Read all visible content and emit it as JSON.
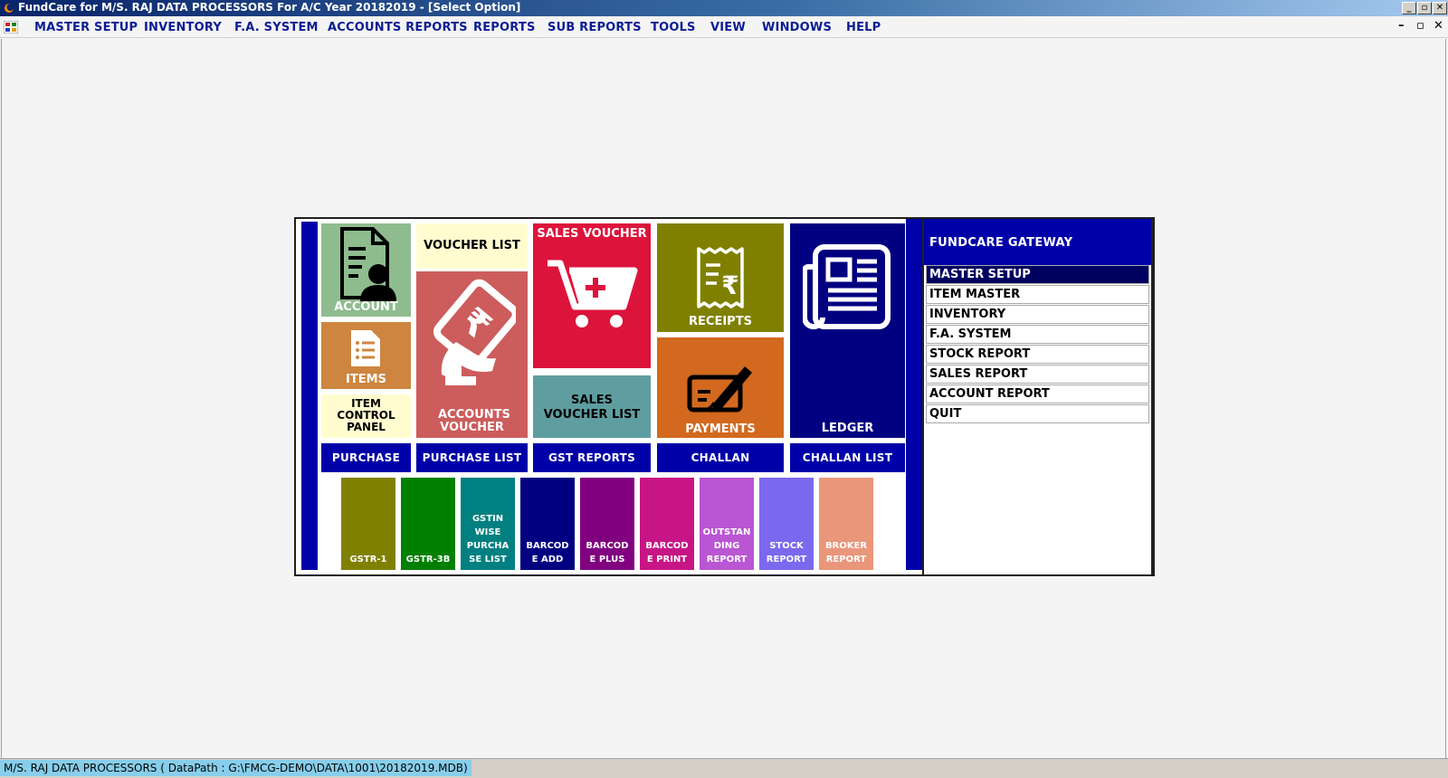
{
  "window": {
    "title": "FundCare  for M/S. RAJ DATA PROCESSORS For A/C Year 20182019 - [Select Option]",
    "controls": {
      "minimize": "_",
      "restore": "▫",
      "close": "✕"
    }
  },
  "menubar": {
    "items": [
      "MASTER SETUP",
      "INVENTORY",
      "F.A. SYSTEM",
      "ACCOUNTS REPORTS",
      "REPORTS",
      "SUB REPORTS",
      "TOOLS",
      "VIEW",
      "WINDOWS",
      "HELP"
    ],
    "child_controls": {
      "minimize": "–",
      "restore": "▫",
      "close": "✕"
    }
  },
  "tiles": {
    "account": {
      "label": "ACCOUNT",
      "color": "#8fbc8f"
    },
    "items": {
      "label": "ITEMS",
      "color": "#cd853f"
    },
    "item_control_panel": {
      "label": "ITEM CONTROL PANEL",
      "color": "#fffdd0"
    },
    "voucher_list": {
      "label": "VOUCHER LIST",
      "color": "#fffdd0"
    },
    "accounts_voucher": {
      "label": "ACCOUNTS VOUCHER",
      "color": "#cd5c5c"
    },
    "sales_voucher": {
      "label": "SALES VOUCHER",
      "color": "#dc143c"
    },
    "sales_voucher_list": {
      "label": "SALES VOUCHER LIST",
      "color": "#5f9ea0"
    },
    "receipts": {
      "label": "RECEIPTS",
      "color": "#808000"
    },
    "payments": {
      "label": "PAYMENTS",
      "color": "#d2691e"
    },
    "ledger": {
      "label": "LEDGER",
      "color": "#000080"
    }
  },
  "navy_buttons": [
    "PURCHASE",
    "PURCHASE LIST",
    "GST REPORTS",
    "CHALLAN",
    "CHALLAN LIST"
  ],
  "small_tiles": [
    {
      "label": "GSTR-1",
      "color": "#808000"
    },
    {
      "label": "GSTR-3B",
      "color": "#008000"
    },
    {
      "label": "GSTIN\nWISE\nPURCHA\nSE LIST",
      "color": "#008080"
    },
    {
      "label": "BARCOD\nE ADD",
      "color": "#000080"
    },
    {
      "label": "BARCOD\nE PLUS",
      "color": "#800080"
    },
    {
      "label": "BARCOD\nE PRINT",
      "color": "#c71585"
    },
    {
      "label": "OUTSTAN\nDING\nREPORT",
      "color": "#ba55d3"
    },
    {
      "label": "STOCK\nREPORT",
      "color": "#7b68ee"
    },
    {
      "label": "BROKER\nREPORT",
      "color": "#e9967a"
    }
  ],
  "gateway": {
    "title": "FUNDCARE GATEWAY",
    "items": [
      "MASTER SETUP",
      "ITEM MASTER",
      "INVENTORY",
      "F.A. SYSTEM",
      "STOCK REPORT",
      "SALES REPORT",
      "ACCOUNT REPORT",
      "QUIT"
    ],
    "active_item": "MASTER SETUP"
  },
  "statusbar": {
    "text": "M/S. RAJ DATA PROCESSORS ( DataPath : G:\\FMCG-DEMO\\DATA\\1001\\20182019.MDB)"
  }
}
